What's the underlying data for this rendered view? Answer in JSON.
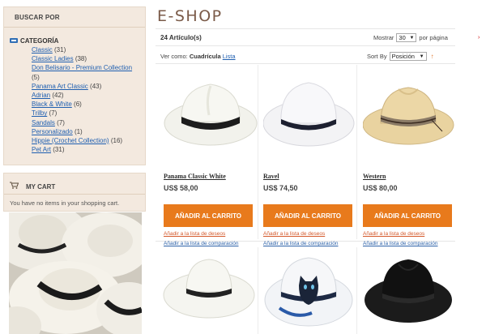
{
  "sidebar": {
    "filter_title": "BUSCAR POR",
    "category_label": "CATEGORÍA",
    "categories": [
      {
        "name": "Classic",
        "count": "(31)"
      },
      {
        "name": "Classic Ladies",
        "count": "(38)"
      },
      {
        "name": "Don Belisario - Premium Collection",
        "count": "(5)"
      },
      {
        "name": "Panama Art Classic",
        "count": "(43)"
      },
      {
        "name": "Adrian",
        "count": "(42)"
      },
      {
        "name": "Black & White",
        "count": "(6)"
      },
      {
        "name": "Trilby",
        "count": "(7)"
      },
      {
        "name": "Sandals",
        "count": "(7)"
      },
      {
        "name": "Personalizado",
        "count": "(1)"
      },
      {
        "name": "Hippie (Crochet Collection)",
        "count": "(16)"
      },
      {
        "name": "Pet Art",
        "count": "(31)"
      }
    ],
    "cart_title": "MY CART",
    "cart_empty": "You have no items in your shopping cart."
  },
  "main": {
    "title": "E-SHOP",
    "count": "24 Artículo(s)",
    "show_label": "Mostrar",
    "show_value": "30",
    "per_page": "por página",
    "view_label": "Ver como:",
    "view_grid": "Cuadrícula",
    "view_list": "Lista",
    "sort_label": "Sort By",
    "sort_value": "Posición"
  },
  "products": [
    {
      "name": "Panama Classic White",
      "price": "US$ 58,00",
      "button": "AÑADIR AL CARRITO",
      "wishlist": "Añadir a la lista de deseos",
      "compare": "Añadir a la lista de comparación"
    },
    {
      "name": "Ravel",
      "price": "US$ 74,50",
      "button": "AÑADIR AL CARRITO",
      "wishlist": "Añadir a la lista de deseos",
      "compare": "Añadir a la lista de comparación"
    },
    {
      "name": "Western",
      "price": "US$ 80,00",
      "button": "AÑADIR AL CARRITO",
      "wishlist": "Añadir a la lista de deseos",
      "compare": "Añadir a la lista de comparación"
    }
  ],
  "icons": {
    "category": "category-list-icon",
    "cart": "cart-icon",
    "select_arrow": "chevron-down-icon",
    "sort_direction": "sort-arrow-icon"
  },
  "colors": {
    "accent": "#e87a1c",
    "sidebar_bg": "#f3e9df",
    "link": "#1f5fb0",
    "wishlist_link": "#d4582a",
    "title": "#7a5a48"
  }
}
